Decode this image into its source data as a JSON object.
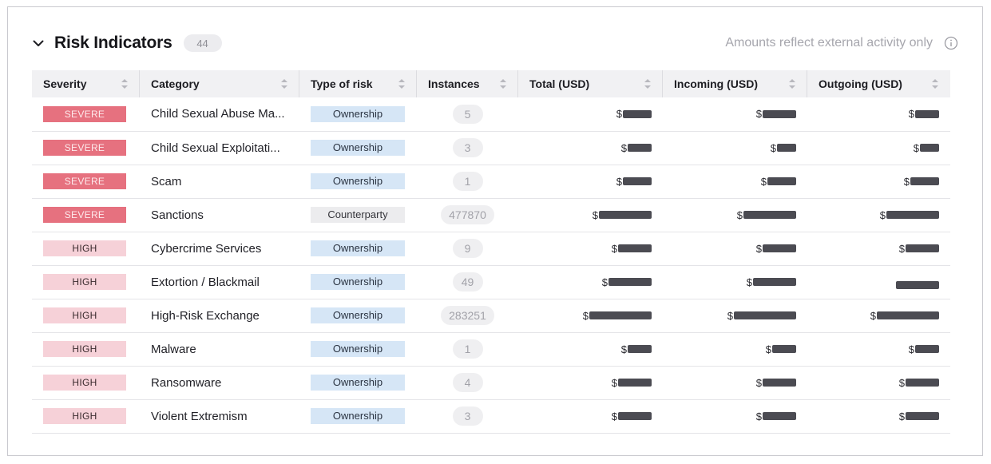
{
  "panel": {
    "title": "Risk Indicators",
    "count": "44",
    "note": "Amounts reflect external activity only",
    "icons": {
      "collapse": "chevron-down-icon",
      "info": "info-icon",
      "sort": "sort-icon"
    }
  },
  "columns": [
    "Severity",
    "Category",
    "Type of risk",
    "Instances",
    "Total (USD)",
    "Incoming (USD)",
    "Outgoing (USD)"
  ],
  "colors": {
    "severe": "#e6717f",
    "high": "#f6d1d8",
    "ownership": "#d6e6f6",
    "counterparty": "#ececee"
  },
  "rows": [
    {
      "severity": "SEVERE",
      "level": "severe",
      "category": "Child Sexual Abuse Ma...",
      "type": "Ownership",
      "kind": "ownership",
      "instances": "5",
      "total": "$",
      "incoming": "$",
      "outgoing": "$",
      "redact": [
        6,
        7,
        5
      ]
    },
    {
      "severity": "SEVERE",
      "level": "severe",
      "category": "Child Sexual Exploitati...",
      "type": "Ownership",
      "kind": "ownership",
      "instances": "3",
      "total": "$",
      "incoming": "$",
      "outgoing": "$",
      "redact": [
        5,
        4,
        4
      ]
    },
    {
      "severity": "SEVERE",
      "level": "severe",
      "category": "Scam",
      "type": "Ownership",
      "kind": "ownership",
      "instances": "1",
      "total": "$",
      "incoming": "$",
      "outgoing": "$",
      "redact": [
        6,
        6,
        6
      ]
    },
    {
      "severity": "SEVERE",
      "level": "severe",
      "category": "Sanctions",
      "type": "Counterparty",
      "kind": "counterparty",
      "instances": "477870",
      "total": "$",
      "incoming": "$",
      "outgoing": "$",
      "redact": [
        11,
        11,
        11
      ]
    },
    {
      "severity": "HIGH",
      "level": "high",
      "category": "Cybercrime Services",
      "type": "Ownership",
      "kind": "ownership",
      "instances": "9",
      "total": "$",
      "incoming": "$",
      "outgoing": "$",
      "redact": [
        7,
        7,
        7
      ]
    },
    {
      "severity": "HIGH",
      "level": "high",
      "category": "Extortion / Blackmail",
      "type": "Ownership",
      "kind": "ownership",
      "instances": "49",
      "total": "$",
      "incoming": "$",
      "outgoing": "",
      "redact": [
        9,
        9,
        9
      ]
    },
    {
      "severity": "HIGH",
      "level": "high",
      "category": "High-Risk Exchange",
      "type": "Ownership",
      "kind": "ownership",
      "instances": "283251",
      "total": "$",
      "incoming": "$",
      "outgoing": "$",
      "redact": [
        13,
        13,
        13
      ]
    },
    {
      "severity": "HIGH",
      "level": "high",
      "category": "Malware",
      "type": "Ownership",
      "kind": "ownership",
      "instances": "1",
      "total": "$",
      "incoming": "$",
      "outgoing": "$",
      "redact": [
        5,
        5,
        5
      ]
    },
    {
      "severity": "HIGH",
      "level": "high",
      "category": "Ransomware",
      "type": "Ownership",
      "kind": "ownership",
      "instances": "4",
      "total": "$",
      "incoming": "$",
      "outgoing": "$",
      "redact": [
        7,
        7,
        7
      ]
    },
    {
      "severity": "HIGH",
      "level": "high",
      "category": "Violent Extremism",
      "type": "Ownership",
      "kind": "ownership",
      "instances": "3",
      "total": "$",
      "incoming": "$",
      "outgoing": "$",
      "redact": [
        7,
        7,
        7
      ]
    }
  ]
}
